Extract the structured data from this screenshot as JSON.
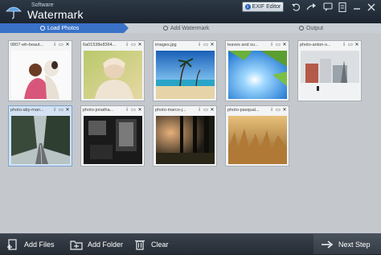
{
  "app": {
    "small_label": "Software",
    "title": "Watermark"
  },
  "toolbar": {
    "exif_label": "EXIF Editor",
    "exif_badge": "i"
  },
  "steps": [
    {
      "label": "Load Photos"
    },
    {
      "label": "Add Watermark"
    },
    {
      "label": "Output"
    }
  ],
  "photos": [
    {
      "name": "0807-wh-beaut...",
      "selected": false,
      "scene": "woman-dog"
    },
    {
      "name": "6a01538e8364...",
      "selected": false,
      "scene": "baby"
    },
    {
      "name": "images.jpg",
      "selected": false,
      "scene": "beach"
    },
    {
      "name": "leaves and su...",
      "selected": false,
      "scene": "sun-leaves"
    },
    {
      "name": "photo-anton-s...",
      "selected": false,
      "scene": "snow-town"
    },
    {
      "name": "photo-aby-man...",
      "selected": true,
      "scene": "forest-road"
    },
    {
      "name": "photo-jonatha...",
      "selected": false,
      "scene": "dark-room"
    },
    {
      "name": "photo-marco-j...",
      "selected": false,
      "scene": "dark-forest"
    },
    {
      "name": "photo-pasqual...",
      "selected": false,
      "scene": "golden-grass"
    }
  ],
  "card_icons": {
    "info": "i",
    "window": "▭",
    "close": "✕"
  },
  "bottom": {
    "add_files": "Add Files",
    "add_folder": "Add Folder",
    "clear": "Clear",
    "next_step": "Next Step"
  },
  "colors": {
    "accent": "#3a72c8",
    "selected_card": "#d3e2f3",
    "workspace": "#c4c8cd"
  }
}
